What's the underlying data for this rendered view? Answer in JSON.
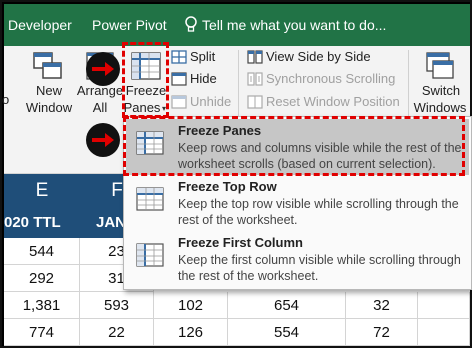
{
  "tabs": {
    "developer": "Developer",
    "power_pivot": "Power Pivot",
    "tell_me": "Tell me what you want to do..."
  },
  "ribbon": {
    "new_window": [
      "New",
      "Window"
    ],
    "new_window_clip": "o",
    "arrange_all": [
      "Arrange",
      "All"
    ],
    "freeze_panes": [
      "Freeze",
      "Panes"
    ],
    "split": "Split",
    "hide": "Hide",
    "unhide": "Unhide",
    "view_side_by_side": "View Side by Side",
    "synchronous_scrolling": "Synchronous Scrolling",
    "reset_window_position": "Reset Window Position",
    "switch_windows": [
      "Switch",
      "Windows"
    ]
  },
  "sheet": {
    "col_headers": [
      "E",
      "F"
    ],
    "sub_headers": [
      "020 TTL",
      "JAN"
    ],
    "rows": [
      [
        "544",
        "23",
        "",
        "",
        ""
      ],
      [
        "292",
        "31",
        "",
        "",
        ""
      ],
      [
        "1,381",
        "593",
        "102",
        "654",
        "32"
      ],
      [
        "774",
        "22",
        "126",
        "554",
        "72"
      ]
    ]
  },
  "menu": {
    "items": [
      {
        "title": "Freeze Panes",
        "desc": "Keep rows and columns visible while the rest of the worksheet scrolls (based on current selection)."
      },
      {
        "title": "Freeze Top Row",
        "desc": "Keep the top row visible while scrolling through the rest of the worksheet."
      },
      {
        "title": "Freeze First Column",
        "desc": "Keep the first column visible while scrolling through the rest of the worksheet."
      }
    ]
  },
  "colors": {
    "tab_bg": "#217346",
    "header_bg": "#1f4e79",
    "annotation": "#e00000",
    "highlight": "#c6c6c6"
  }
}
